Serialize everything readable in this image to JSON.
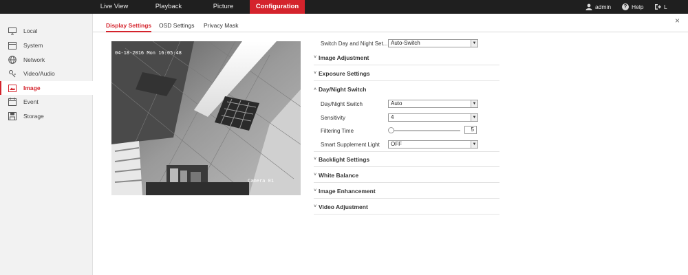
{
  "topnav": {
    "items": [
      {
        "label": "Live View",
        "active": false
      },
      {
        "label": "Playback",
        "active": false
      },
      {
        "label": "Picture",
        "active": false
      },
      {
        "label": "Configuration",
        "active": true
      }
    ],
    "user_label": "admin",
    "help_label": "Help",
    "logout_label": "L"
  },
  "sidebar": {
    "items": [
      {
        "label": "Local",
        "icon": "monitor-icon",
        "active": false
      },
      {
        "label": "System",
        "icon": "system-icon",
        "active": false
      },
      {
        "label": "Network",
        "icon": "globe-icon",
        "active": false
      },
      {
        "label": "Video/Audio",
        "icon": "video-audio-icon",
        "active": false
      },
      {
        "label": "Image",
        "icon": "image-icon",
        "active": true
      },
      {
        "label": "Event",
        "icon": "calendar-icon",
        "active": false
      },
      {
        "label": "Storage",
        "icon": "storage-icon",
        "active": false
      }
    ]
  },
  "subtabs": [
    {
      "label": "Display Settings",
      "active": true
    },
    {
      "label": "OSD Settings",
      "active": false
    },
    {
      "label": "Privacy Mask",
      "active": false
    }
  ],
  "preview": {
    "timestamp": "04-18-2016 Mon 16:05:48",
    "camera_name": "Camera 01"
  },
  "settings": {
    "switch_day_night": {
      "label": "Switch Day and Night Set...",
      "value": "Auto-Switch"
    },
    "sections": {
      "image_adjustment": "Image Adjustment",
      "exposure_settings": "Exposure Settings",
      "day_night_switch": "Day/Night Switch",
      "backlight_settings": "Backlight Settings",
      "white_balance": "White Balance",
      "image_enhancement": "Image Enhancement",
      "video_adjustment": "Video Adjustment"
    },
    "day_night": {
      "mode": {
        "label": "Day/Night Switch",
        "value": "Auto"
      },
      "sensitivity": {
        "label": "Sensitivity",
        "value": "4"
      },
      "filtering_time": {
        "label": "Filtering Time",
        "value": "5"
      },
      "smart_supplement": {
        "label": "Smart Supplement Light",
        "value": "OFF"
      }
    }
  },
  "colors": {
    "accent": "#d4232c",
    "topbar": "#1f1f1f",
    "sidebar": "#f2f2f2"
  }
}
